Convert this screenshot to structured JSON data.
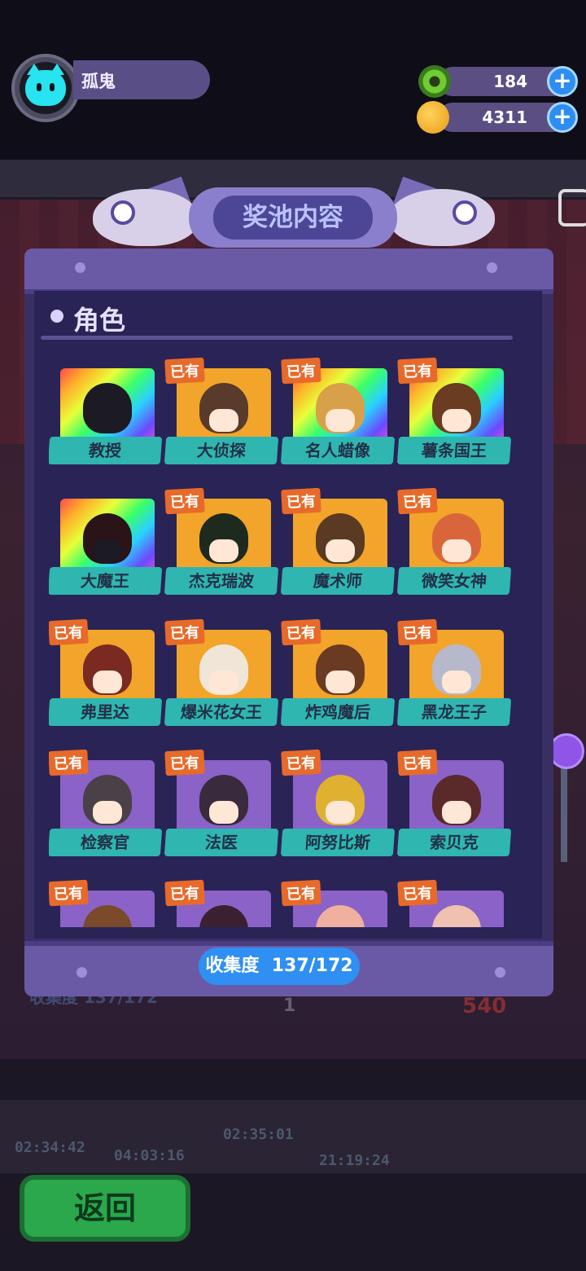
{
  "player": {
    "name": "孤鬼"
  },
  "currency": [
    {
      "icon": "donut-coin-icon",
      "value": "184"
    },
    {
      "icon": "planet-coin-icon",
      "value": "4311"
    }
  ],
  "panel": {
    "title": "奖池内容",
    "section": "角色",
    "owned_tag": "已有",
    "collection_label": "收集度",
    "collection_value": "137/172"
  },
  "characters": [
    {
      "name": "教授",
      "owned": false,
      "bg": "rainbow",
      "hair": "#1c1a22"
    },
    {
      "name": "大侦探",
      "owned": true,
      "bg": "#f2a52a",
      "hair": "#5a3a2a"
    },
    {
      "name": "名人蜡像",
      "owned": true,
      "bg": "rainbow",
      "hair": "#d9a04a"
    },
    {
      "name": "薯条国王",
      "owned": true,
      "bg": "rainbow",
      "hair": "#6a3c22"
    },
    {
      "name": "大魔王",
      "owned": false,
      "bg": "rainbow",
      "hair": "#2a1418"
    },
    {
      "name": "杰克瑞波",
      "owned": true,
      "bg": "#f2a52a",
      "hair": "#1e2a1e"
    },
    {
      "name": "魔术师",
      "owned": true,
      "bg": "#f2a52a",
      "hair": "#5a3a22"
    },
    {
      "name": "微笑女神",
      "owned": true,
      "bg": "#f2a52a",
      "hair": "#d9663a"
    },
    {
      "name": "弗里达",
      "owned": true,
      "bg": "#f2a52a",
      "hair": "#7a2a20"
    },
    {
      "name": "爆米花女王",
      "owned": true,
      "bg": "#f2a52a",
      "hair": "#f0e6d8"
    },
    {
      "name": "炸鸡魔后",
      "owned": true,
      "bg": "#f2a52a",
      "hair": "#6a3a22"
    },
    {
      "name": "黑龙王子",
      "owned": true,
      "bg": "#f2a52a",
      "hair": "#b8b8cc"
    },
    {
      "name": "检察官",
      "owned": true,
      "bg": "#8a62c8",
      "hair": "#4a4048"
    },
    {
      "name": "法医",
      "owned": true,
      "bg": "#8a62c8",
      "hair": "#3a2a3e"
    },
    {
      "name": "阿努比斯",
      "owned": true,
      "bg": "#8a62c8",
      "hair": "#e0b030"
    },
    {
      "name": "索贝克",
      "owned": true,
      "bg": "#8a62c8",
      "hair": "#5a2a2a"
    },
    {
      "name": "",
      "owned": true,
      "bg": "#8a62c8",
      "hair": "#7a4a2a"
    },
    {
      "name": "",
      "owned": true,
      "bg": "#8a62c8",
      "hair": "#3a2030"
    },
    {
      "name": "",
      "owned": true,
      "bg": "#8a62c8",
      "hair": "#f0b0a0"
    },
    {
      "name": "",
      "owned": true,
      "bg": "#8a62c8",
      "hair": "#f0c0b0"
    }
  ],
  "background": {
    "timers": [
      "02:34:42",
      "04:03:16",
      "02:35:01",
      "21:19:24"
    ],
    "collection_label": "收集度",
    "collection_value": "137/172",
    "count_a": "1",
    "count_b": "540"
  },
  "back_button": "返回",
  "colors": {
    "owned_tag": "#e86a2a",
    "name_label": "#2fb6b0",
    "panel": "#2a2356",
    "accent_blue": "#2f8ff2"
  }
}
